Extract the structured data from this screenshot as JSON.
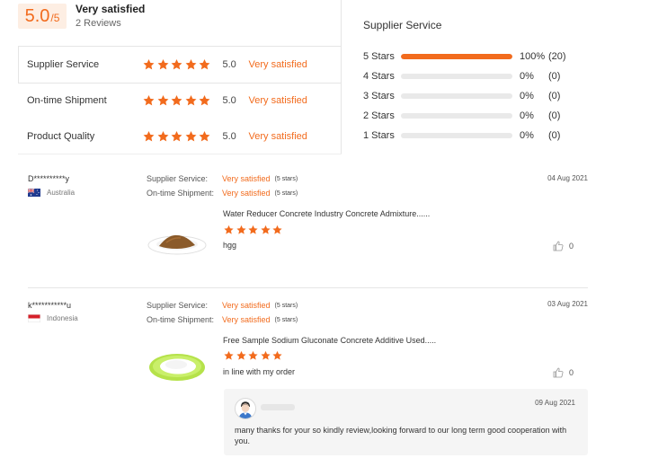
{
  "summary": {
    "score": "5.0",
    "score_max": "/5",
    "overall": "Very satisfied",
    "reviews_count": "2 Reviews"
  },
  "categories": [
    {
      "label": "Supplier Service",
      "stars": 5,
      "score": "5.0",
      "desc": "Very satisfied"
    },
    {
      "label": "On-time Shipment",
      "stars": 5,
      "score": "5.0",
      "desc": "Very satisfied"
    },
    {
      "label": "Product Quality",
      "stars": 5,
      "score": "5.0",
      "desc": "Very satisfied"
    }
  ],
  "distribution": {
    "title": "Supplier Service",
    "rows": [
      {
        "label": "5  Stars",
        "fraction": 1.0,
        "pct": "100%",
        "count": "(20)"
      },
      {
        "label": "4  Stars",
        "fraction": 0,
        "pct": "0%",
        "count": "(0)"
      },
      {
        "label": "3  Stars",
        "fraction": 0,
        "pct": "0%",
        "count": "(0)"
      },
      {
        "label": "2  Stars",
        "fraction": 0,
        "pct": "0%",
        "count": "(0)"
      },
      {
        "label": "1  Stars",
        "fraction": 0,
        "pct": "0%",
        "count": "(0)"
      }
    ]
  },
  "reviews": [
    {
      "user": "D**********y",
      "country": "Australia",
      "service_label": "Supplier Service:",
      "service_value": "Very satisfied",
      "service_stars": "(5 stars)",
      "shipment_label": "On-time Shipment:",
      "shipment_value": "Very satisfied",
      "shipment_stars": "(5 stars)",
      "date": "04 Aug 2021",
      "product": "Water Reducer Concrete Industry Concrete Admixture......",
      "rating": 5,
      "comment": "hgg",
      "likes": "0"
    },
    {
      "user": "k***********u",
      "country": "Indonesia",
      "service_label": "Supplier Service:",
      "service_value": "Very satisfied",
      "service_stars": "(5 stars)",
      "shipment_label": "On-time Shipment:",
      "shipment_value": "Very satisfied",
      "shipment_stars": "(5 stars)",
      "date": "03 Aug 2021",
      "product": "Free Sample Sodium Gluconate Concrete Additive Used.....",
      "rating": 5,
      "comment": "in line with my order",
      "likes": "0",
      "reply": {
        "date": "09 Aug 2021",
        "text": "many thanks for your so kindly review,looking forward to our long term good cooperation with you."
      }
    }
  ],
  "colors": {
    "accent": "#f26b1d",
    "score_bg": "#fdeee3"
  },
  "icons": {
    "star": "star-icon",
    "like": "thumbs-up-icon"
  }
}
